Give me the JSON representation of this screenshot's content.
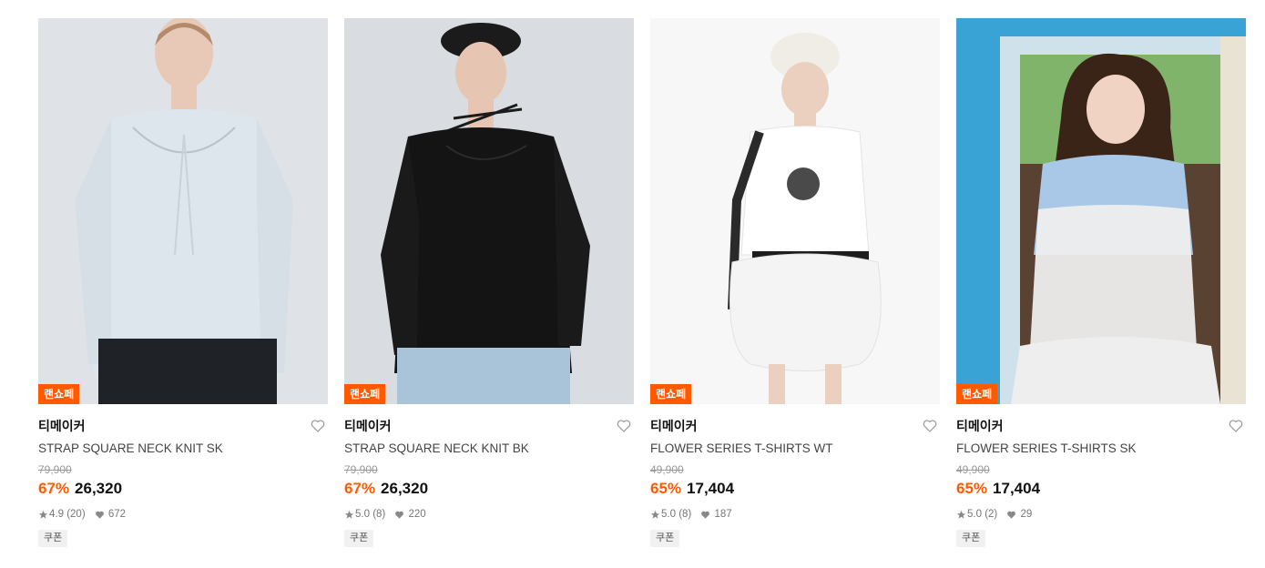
{
  "products": [
    {
      "badge": "랜쇼페",
      "brand": "티메이커",
      "name": "STRAP SQUARE NECK KNIT SK",
      "original_price": "79,900",
      "discount": "67%",
      "price": "26,320",
      "rating": "4.9",
      "reviews": "(20)",
      "likes": "672",
      "coupon": "쿠폰",
      "colors": {
        "bg": "#dfe3e7",
        "top": "#dde6ec",
        "bottom": "#1f2226",
        "skin": "#e8c9b8",
        "hair": "#b48a6a"
      }
    },
    {
      "badge": "랜쇼페",
      "brand": "티메이커",
      "name": "STRAP SQUARE NECK KNIT BK",
      "original_price": "79,900",
      "discount": "67%",
      "price": "26,320",
      "rating": "5.0",
      "reviews": "(8)",
      "likes": "220",
      "coupon": "쿠폰",
      "colors": {
        "bg": "#d9dde1",
        "top": "#141414",
        "bottom": "#a9c3d9",
        "skin": "#e6c5b3",
        "hair": "#1b1b1b"
      }
    },
    {
      "badge": "랜쇼페",
      "brand": "티메이커",
      "name": "FLOWER SERIES T-SHIRTS WT",
      "original_price": "49,900",
      "discount": "65%",
      "price": "17,404",
      "rating": "5.0",
      "reviews": "(8)",
      "likes": "187",
      "coupon": "쿠폰",
      "colors": {
        "bg": "#f7f7f7",
        "top": "#ffffff",
        "bottom": "#f4f4f4",
        "skin": "#ecd0bf",
        "hair": "#efede6"
      }
    },
    {
      "badge": "랜쇼페",
      "brand": "티메이커",
      "name": "FLOWER SERIES T-SHIRTS SK",
      "original_price": "49,900",
      "discount": "65%",
      "price": "17,404",
      "rating": "5.0",
      "reviews": "(2)",
      "likes": "29",
      "coupon": "쿠폰",
      "colors": {
        "bg": "#3aa3d6",
        "top": "#a9c8e8",
        "bottom": "#eeeeee",
        "skin": "#f1d3c3",
        "hair": "#3a2418"
      }
    }
  ],
  "icons": {
    "wish": "heart-outline-icon",
    "star": "star-icon",
    "likes": "heart-filled-icon"
  }
}
